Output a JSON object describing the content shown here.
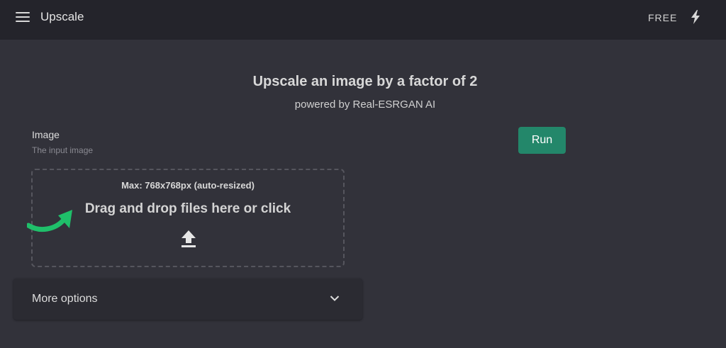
{
  "header": {
    "title": "Upscale",
    "plan_label": "FREE",
    "menu_icon": "hamburger-menu-icon",
    "bolt_icon": "lightning-bolt-icon"
  },
  "main": {
    "title": "Upscale an image by a factor of 2",
    "subtitle": "powered by Real-ESRGAN AI",
    "run_label": "Run"
  },
  "image_field": {
    "label": "Image",
    "hint": "The input image",
    "max_note": "Max: 768x768px (auto-resized)",
    "drop_text": "Drag and drop files here or click",
    "upload_icon": "upload-icon"
  },
  "options": {
    "label": "More options",
    "chevron_icon": "chevron-down-icon"
  },
  "colors": {
    "background": "#32323a",
    "topbar": "#24242b",
    "run_button": "#23876a",
    "arrow": "#1fbf6a"
  }
}
